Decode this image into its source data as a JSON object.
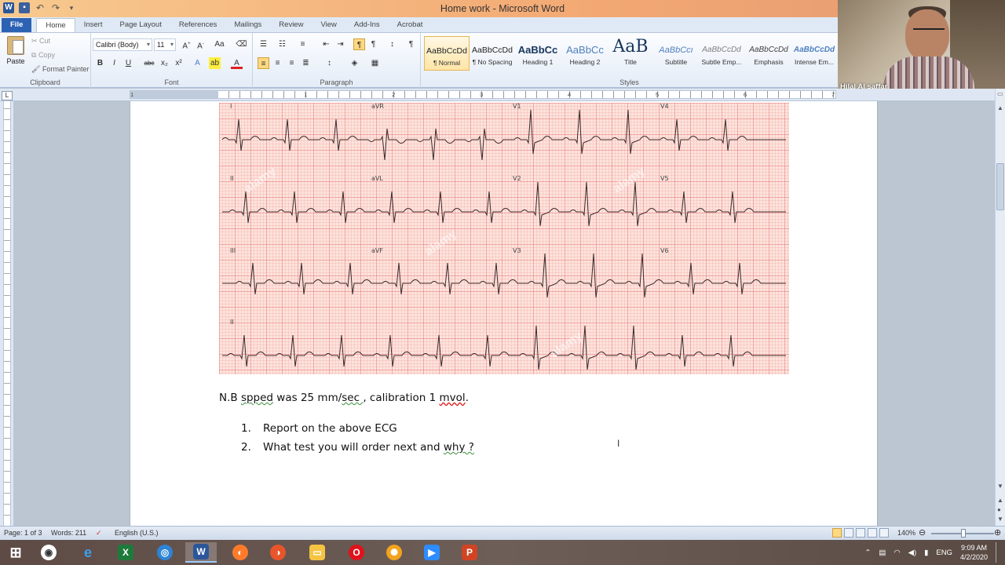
{
  "window": {
    "title": "Home work  -  Microsoft Word",
    "word_icon": "W",
    "controls": [
      "–",
      "❐",
      "✕"
    ]
  },
  "tabs": [
    "File",
    "Home",
    "Insert",
    "Page Layout",
    "References",
    "Mailings",
    "Review",
    "View",
    "Add-Ins",
    "Acrobat"
  ],
  "clipboard": {
    "paste": "Paste",
    "cut": "Cut",
    "copy": "Copy",
    "format_painter": "Format Painter",
    "label": "Clipboard"
  },
  "font": {
    "name": "Calibri (Body)",
    "size": "11",
    "label": "Font",
    "buttons": [
      "B",
      "I",
      "U",
      "abc",
      "x₂",
      "x²",
      "A",
      "ab",
      "A"
    ]
  },
  "paragraph": {
    "label": "Paragraph"
  },
  "styles": {
    "label": "Styles",
    "items": [
      {
        "preview": "AaBbCcDd",
        "name": "¶ Normal"
      },
      {
        "preview": "AaBbCcDd",
        "name": "¶ No Spacing"
      },
      {
        "preview": "AaBbCc",
        "name": "Heading 1"
      },
      {
        "preview": "AaBbCc",
        "name": "Heading 2"
      },
      {
        "preview": "AaB",
        "name": "Title"
      },
      {
        "preview": "AaBbCcı",
        "name": "Subtitle"
      },
      {
        "preview": "AaBbCcDd",
        "name": "Subtle Emp..."
      },
      {
        "preview": "AaBbCcDd",
        "name": "Emphasis"
      },
      {
        "preview": "AaBbCcDd",
        "name": "Intense Em..."
      }
    ],
    "colors": {
      "heading": "#17365d",
      "subtitle": "#4f81bd",
      "emphasis": "#404040"
    }
  },
  "webcam": {
    "name": "Hilal Al saffar"
  },
  "ruler_ticks": [
    "1",
    "1",
    "2",
    "3",
    "4",
    "5",
    "6",
    "7"
  ],
  "ecg": {
    "leads": [
      "I",
      "aVR",
      "V1",
      "V4",
      "II",
      "aVL",
      "V2",
      "V5",
      "III",
      "aVF",
      "V3",
      "V6",
      "II"
    ],
    "watermark": "alamy",
    "colors": {
      "grid_major": "#e67878",
      "paper": "#fde3dc",
      "trace": "#3a2a2a"
    }
  },
  "document": {
    "nb_prefix": "N.B ",
    "nb_spped": "spped",
    "nb_mid": " was 25 mm/",
    "nb_sec": "sec  ",
    "nb_after": ", calibration 1 ",
    "nb_mvol": "mvol",
    "nb_end": ".",
    "questions": [
      {
        "num": "1.",
        "text": "Report on the above ECG",
        "tail": ""
      },
      {
        "num": "2.",
        "text": "What test you will order next and ",
        "tail": "why ?"
      }
    ]
  },
  "status": {
    "page": "Page: 1 of 3",
    "words": "Words: 211",
    "language": "English (U.S.)",
    "zoom": "140%"
  },
  "taskbar": {
    "apps": [
      "start",
      "chrome",
      "ie",
      "excel",
      "browser",
      "word",
      "firefox",
      "firefox-dev",
      "explorer",
      "opera",
      "settings",
      "zoom",
      "powerpoint"
    ],
    "tray_lang": "ENG",
    "time": "9:09 AM",
    "date": "4/2/2020"
  }
}
